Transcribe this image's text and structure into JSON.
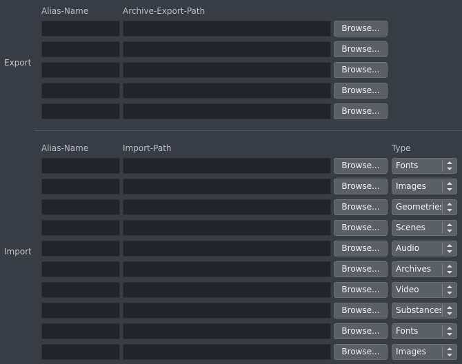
{
  "theme": {
    "background": "#383c44",
    "field_bg": "#21242a",
    "button_bg": "#5b5f66",
    "text": "#c7cbd1",
    "divider": "#50545c"
  },
  "export_section": {
    "label": "Export",
    "columns": {
      "alias": "Alias-Name",
      "path": "Archive-Export-Path"
    },
    "browse_label": "Browse...",
    "rows": [
      {
        "alias": "",
        "path": "",
        "browse": "Browse..."
      },
      {
        "alias": "",
        "path": "",
        "browse": "Browse..."
      },
      {
        "alias": "",
        "path": "",
        "browse": "Browse..."
      },
      {
        "alias": "",
        "path": "",
        "browse": "Browse..."
      },
      {
        "alias": "",
        "path": "",
        "browse": "Browse..."
      }
    ]
  },
  "import_section": {
    "label": "Import",
    "columns": {
      "alias": "Alias-Name",
      "path": "Import-Path",
      "type": "Type"
    },
    "browse_label": "Browse...",
    "type_options": [
      "Fonts",
      "Images",
      "Geometries",
      "Scenes",
      "Audio",
      "Archives",
      "Video",
      "Substances"
    ],
    "rows": [
      {
        "alias": "",
        "path": "",
        "browse": "Browse...",
        "type": "Fonts"
      },
      {
        "alias": "",
        "path": "",
        "browse": "Browse...",
        "type": "Images"
      },
      {
        "alias": "",
        "path": "",
        "browse": "Browse...",
        "type": "Geometries"
      },
      {
        "alias": "",
        "path": "",
        "browse": "Browse...",
        "type": "Scenes"
      },
      {
        "alias": "",
        "path": "",
        "browse": "Browse...",
        "type": "Audio"
      },
      {
        "alias": "",
        "path": "",
        "browse": "Browse...",
        "type": "Archives"
      },
      {
        "alias": "",
        "path": "",
        "browse": "Browse...",
        "type": "Video"
      },
      {
        "alias": "",
        "path": "",
        "browse": "Browse...",
        "type": "Substances"
      },
      {
        "alias": "",
        "path": "",
        "browse": "Browse...",
        "type": "Fonts"
      },
      {
        "alias": "",
        "path": "",
        "browse": "Browse...",
        "type": "Images"
      }
    ]
  }
}
